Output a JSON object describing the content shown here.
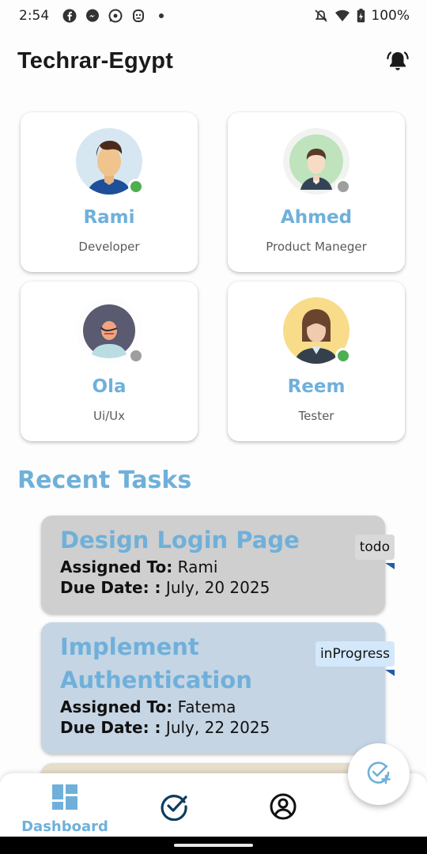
{
  "status_bar": {
    "time": "2:54",
    "battery": "100%",
    "icons": [
      "facebook-icon",
      "messenger-icon",
      "whatsapp-icon",
      "notification-app-icon",
      "dot-icon",
      "mute-icon",
      "wifi-icon",
      "battery-icon"
    ]
  },
  "app_bar": {
    "title": "Techrar-Egypt",
    "bell_icon": "notification-bell-icon"
  },
  "team": [
    {
      "name": "Rami",
      "role": "Developer",
      "online": true
    },
    {
      "name": "Ahmed",
      "role": "Product Maneger",
      "online": false
    },
    {
      "name": "Ola",
      "role": "Ui/Ux",
      "online": false
    },
    {
      "name": "Reem",
      "role": "Tester",
      "online": true
    }
  ],
  "recent_tasks": {
    "title": "Recent Tasks",
    "assigned_label": "Assigned To:",
    "due_label": "Due Date: :",
    "items": [
      {
        "title": "Design Login Page",
        "assigned_to": "Rami",
        "due_date": "July, 20 2025",
        "status": "todo"
      },
      {
        "title": "Implement Authentication",
        "assigned_to": "Fatema",
        "due_date": "July, 22 2025",
        "status": "inProgress"
      }
    ]
  },
  "bottom_nav": {
    "items": [
      {
        "label": "Dashboard",
        "icon": "dashboard-icon",
        "active": true
      },
      {
        "label": "",
        "icon": "tasks-check-icon",
        "active": false
      },
      {
        "label": "",
        "icon": "profile-icon",
        "active": false
      }
    ]
  },
  "fab": {
    "icon": "add-task-icon"
  },
  "colors": {
    "accent": "#6fb0da",
    "online": "#4caf50",
    "offline": "#9e9e9e",
    "nav_dark": "#0d3b5c"
  }
}
